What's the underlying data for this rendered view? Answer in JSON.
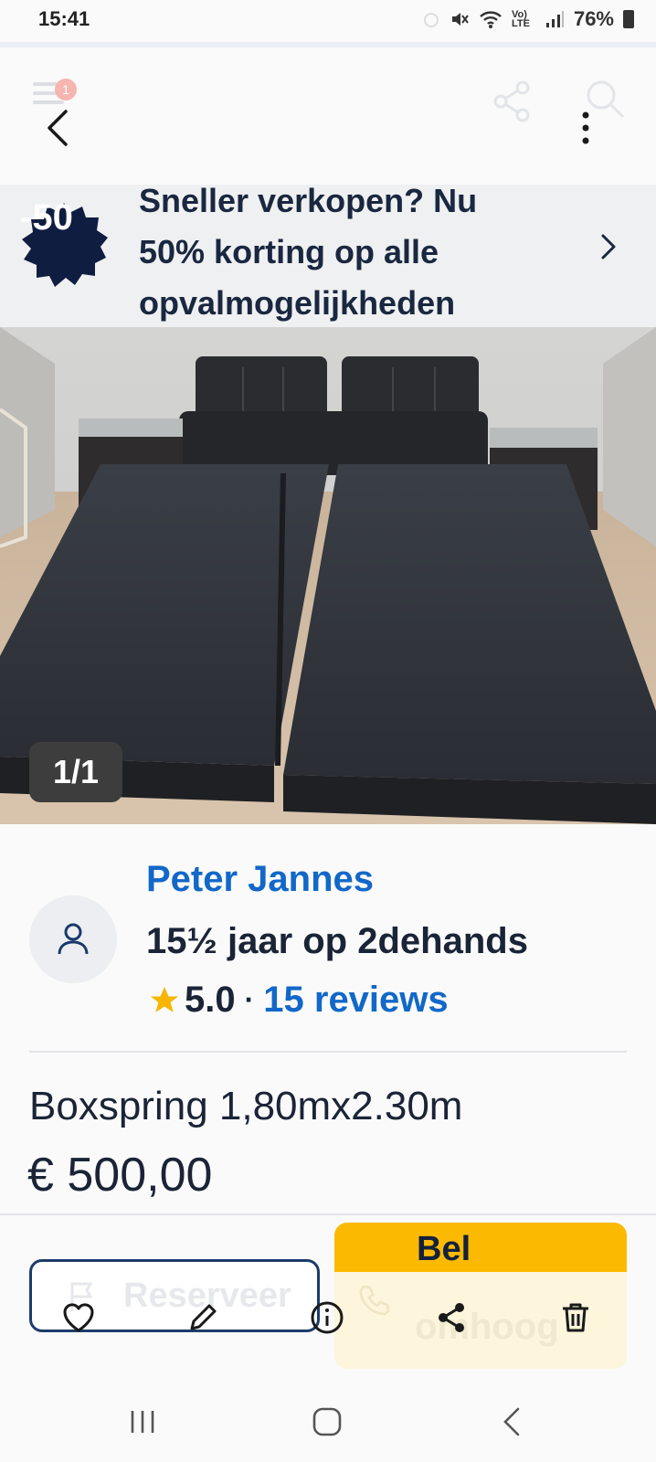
{
  "status_bar": {
    "time": "15:41",
    "network": "Vo) LTE",
    "battery": "76%"
  },
  "header": {
    "menu_badge": "1"
  },
  "promo": {
    "badge": "-50",
    "lines": [
      "Sneller verkopen? Nu",
      "50% korting op alle",
      "opvalmogelijkheden"
    ]
  },
  "gallery": {
    "counter": "1/1"
  },
  "seller": {
    "name": "Peter Jannes",
    "membership": "15½ jaar op 2dehands",
    "rating": "5.0",
    "separator": "·",
    "reviews": "15 reviews"
  },
  "listing": {
    "title": "Boxspring 1,80mx2.30m",
    "price": "€ 500,00"
  },
  "actions": {
    "reserve": "Reserveer",
    "call": "Bel",
    "call_secondary": "omhoog"
  },
  "icons": {
    "back": "chevron-left-icon",
    "more": "more-vertical-icon",
    "heart": "heart-icon",
    "edit": "pencil-icon",
    "info": "info-icon",
    "share": "share-icon",
    "delete": "trash-icon"
  },
  "colors": {
    "accent_blue": "#1268c8",
    "brand_navy": "#14213d",
    "call_yellow": "#fbb900",
    "star": "#f7b500"
  }
}
